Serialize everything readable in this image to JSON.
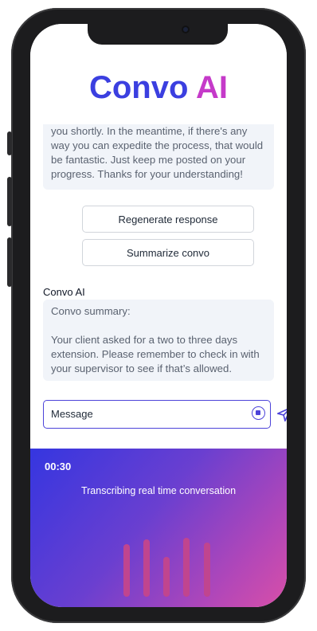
{
  "app": {
    "title_main": "Convo ",
    "title_accent": "AI"
  },
  "chat": {
    "previous_message": "you shortly. In the meantime, if there's any way you can expedite the process, that would be fantastic. Just keep me posted on your progress. Thanks for your understanding!",
    "actions": {
      "regenerate_label": "Regenerate response",
      "summarize_label": "Summarize convo"
    },
    "summary": {
      "sender": "Convo AI",
      "heading": "Convo summary:",
      "body": "Your client asked for a two to three days extension. Please remember to check in with your supervisor to see if that’s allowed."
    }
  },
  "composer": {
    "placeholder": "Message",
    "stop_icon": "stop-circle-icon",
    "send_icon": "send-icon"
  },
  "recording": {
    "timer": "00:30",
    "status": "Transcribing real time conversation"
  },
  "colors": {
    "brand_blue": "#3b3fe0",
    "brand_pink": "#c53ac9",
    "accent": "#4c43d9"
  }
}
